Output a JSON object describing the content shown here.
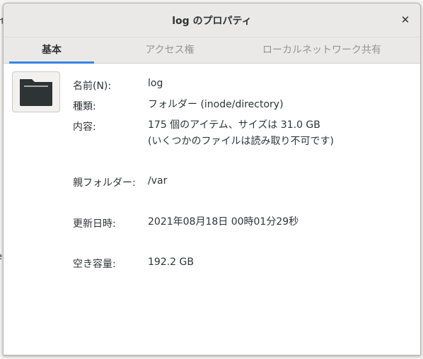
{
  "window": {
    "title": "log のプロパティ",
    "close_symbol": "✕"
  },
  "tabs": [
    {
      "label": "基本",
      "active": true
    },
    {
      "label": "アクセス権",
      "active": false
    },
    {
      "label": "ローカルネットワーク共有",
      "active": false
    }
  ],
  "icon": {
    "name": "folder-icon",
    "color": "#2e3436"
  },
  "properties": {
    "name": {
      "label": "名前(N):",
      "value": "log"
    },
    "type": {
      "label": "種類:",
      "value": "フォルダー (inode/directory)"
    },
    "contents": {
      "label": "内容:",
      "value_line1": "175 個のアイテム、サイズは 31.0 GB",
      "value_line2": "(いくつかのファイルは読み取り不可です)"
    },
    "parent": {
      "label": "親フォルダー:",
      "value": "/var"
    },
    "modified": {
      "label": "更新日時:",
      "value": "2021年08月18日 00時01分29秒"
    },
    "free_space": {
      "label": "空き容量:",
      "value": "192.2 GB"
    }
  },
  "background": {
    "edge_chars": [
      "イ",
      "e"
    ]
  },
  "colors": {
    "accent": "#3584e4",
    "headerbar": "#ebe9e7",
    "text": "#2e3436",
    "tab_inactive": "#929595"
  }
}
